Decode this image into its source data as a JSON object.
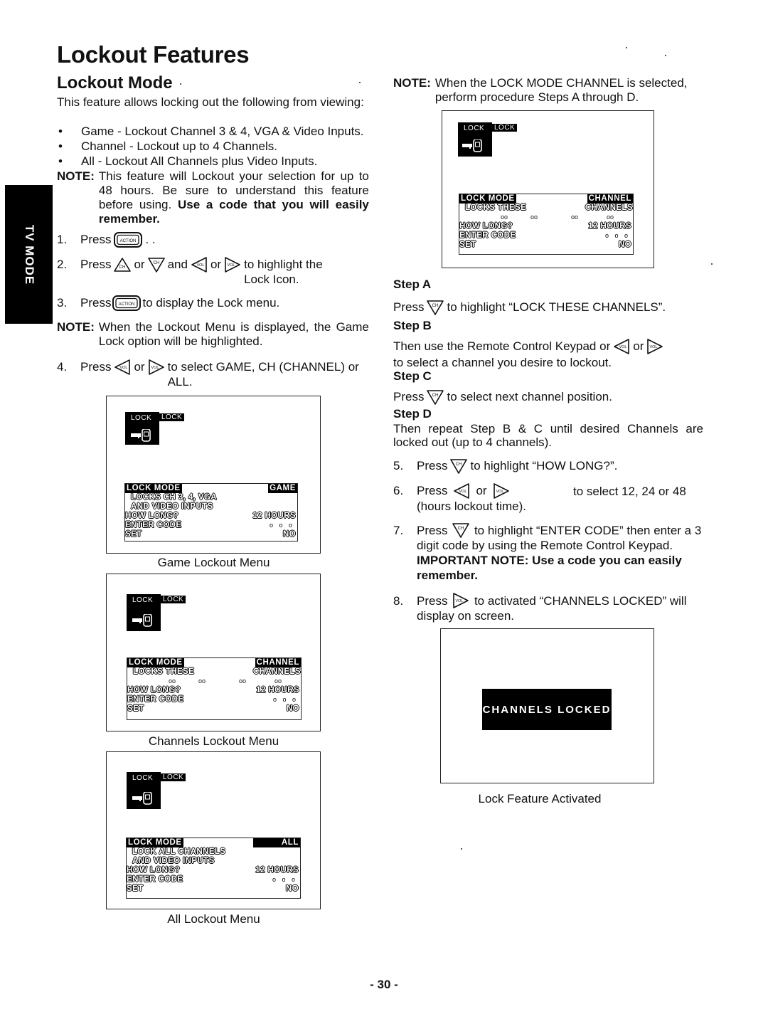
{
  "page": {
    "title": "Lockout Features",
    "section_title": "Lockout Mode",
    "side_tab": "TV MODE",
    "page_number": "- 30 -"
  },
  "left": {
    "intro": "This feature allows locking out the following from viewing:",
    "bullets": [
      "Game - Lockout Channel 3 & 4, VGA & Video Inputs.",
      "Channel - Lockout up to 4 Channels.",
      "All - Lockout All Channels plus Video Inputs."
    ],
    "note1": {
      "label": "NOTE:",
      "text": "This feature will Lockout your selection for up to 48 hours. Be sure to understand this feature before using.",
      "bold_text": "Use a code that you will easily remember."
    },
    "steps": [
      {
        "num": "1.",
        "parts": [
          "Press",
          ". ."
        ],
        "icons": [
          "action-button"
        ]
      },
      {
        "num": "2.",
        "parts": [
          "Press",
          "or",
          "and",
          "or",
          "to highlight the Lock Icon."
        ],
        "icons": [
          "ch-up-button",
          "ch-down-button",
          "vol-left-button",
          "vol-right-button"
        ]
      },
      {
        "num": "3.",
        "parts": [
          "Press",
          "to display the Lock menu."
        ],
        "icons": [
          "action-button"
        ]
      }
    ],
    "note2": {
      "label": "NOTE:",
      "text": "When the Lockout Menu is displayed, the Game Lock option will be highlighted."
    },
    "step4": {
      "num": "4.",
      "parts": [
        "Press",
        "or",
        "to select GAME, CH (CHANNEL) or ALL."
      ]
    }
  },
  "menus": {
    "icon_labels": {
      "lock1": "LOCK",
      "lock2": "LOCK"
    },
    "common": {
      "lock_mode": "LOCK MODE",
      "how_long": "HOW LONG?",
      "hours": "12 HOURS",
      "enter_code": "ENTER CODE",
      "code_dots": "o o o",
      "set": "SET",
      "set_value": "NO"
    },
    "game": {
      "mode_value": "GAME",
      "line1": "LOCKS CH 3, 4, VGA",
      "line2": "AND VIDEO INPUTS",
      "caption": "Game Lockout Menu"
    },
    "channel": {
      "mode_value": "CHANNEL",
      "line1": "LOCKS THESE",
      "line1_right": "CHANNELS",
      "channel_slots": [
        "oo",
        "oo",
        "oo",
        "oo"
      ],
      "caption": "Channels Lockout Menu"
    },
    "all": {
      "mode_value": "ALL",
      "line1": "LOCK ALL CHANNELS",
      "line2": "AND VIDEO INPUTS",
      "caption": "All Lockout Menu"
    }
  },
  "right": {
    "note": {
      "label": "NOTE:",
      "text": "When the LOCK MODE CHANNEL is selected, perform procedure Steps A through D."
    },
    "step_a": {
      "title": "Step A",
      "before": "Press",
      "after": "to highlight “LOCK THESE CHANNELS”."
    },
    "step_b": {
      "title": "Step B",
      "before": "Then use the Remote Control Keypad or",
      "mid": "or",
      "after": "to select a channel you desire to lockout."
    },
    "step_c": {
      "title": "Step C",
      "before": "Press",
      "after": "to select next channel position."
    },
    "step_d": {
      "title": "Step D",
      "text": "Then repeat Step B & C until desired Channels are locked out (up to 4 channels)."
    },
    "step5": {
      "num": "5.",
      "before": "Press",
      "after": "to highlight “HOW LONG?”."
    },
    "step6": {
      "num": "6.",
      "before": "Press",
      "mid": "or",
      "after": "to select 12, 24 or 48 (hours lockout time)."
    },
    "step7": {
      "num": "7.",
      "before": "Press",
      "after": "to highlight “ENTER CODE” then enter a 3 digit code by using the Remote Control Keypad.",
      "bold": "IMPORTANT NOTE:  Use a code you can easily remember."
    },
    "step8": {
      "num": "8.",
      "before": "Press",
      "after": "to activated “CHANNELS LOCKED” will display on screen."
    },
    "locked_banner": "CHANNELS LOCKED",
    "locked_caption": "Lock Feature Activated"
  }
}
